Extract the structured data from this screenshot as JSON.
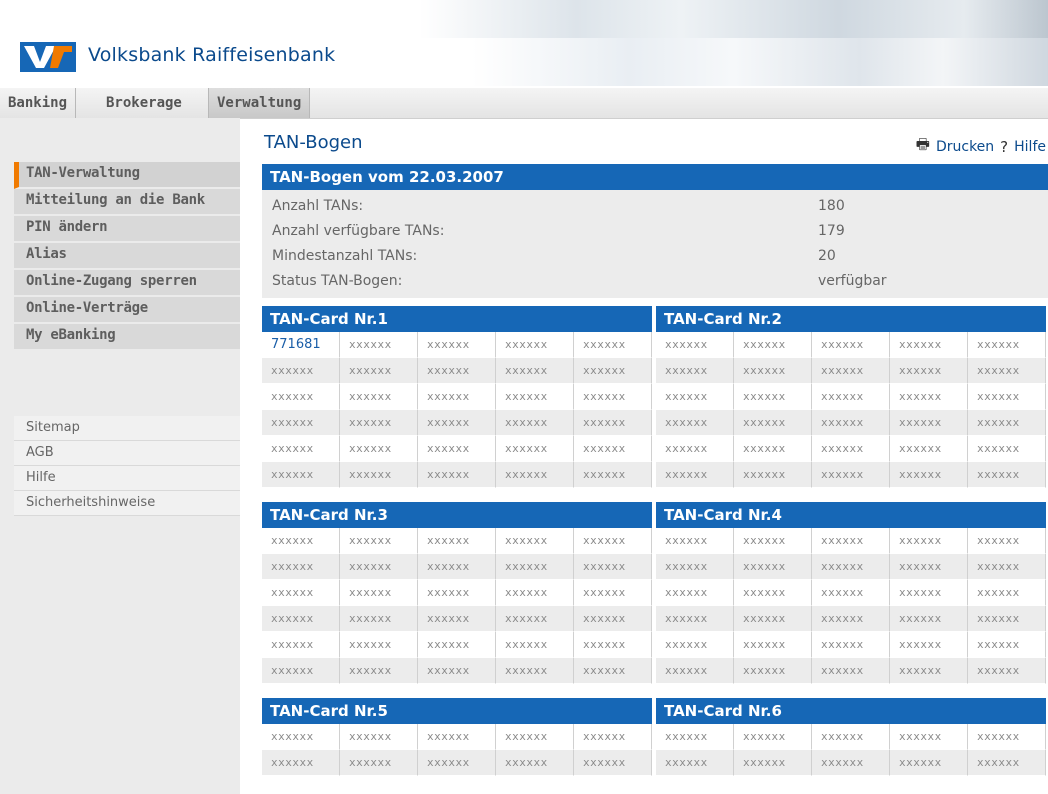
{
  "brand": {
    "name": "Volksbank Raiffeisenbank",
    "primary_color": "#1667b6",
    "accent_color": "#f07a00"
  },
  "tabs": [
    {
      "label": "Banking",
      "active": false
    },
    {
      "label": "Brokerage",
      "active": false
    },
    {
      "label": "Verwaltung",
      "active": true
    }
  ],
  "sidebar": {
    "nav": [
      {
        "label": "TAN-Verwaltung",
        "active": true
      },
      {
        "label": "Mitteilung an die Bank",
        "active": false
      },
      {
        "label": "PIN ändern",
        "active": false
      },
      {
        "label": "Alias",
        "active": false
      },
      {
        "label": "Online-Zugang sperren",
        "active": false
      },
      {
        "label": "Online-Verträge",
        "active": false
      },
      {
        "label": "My eBanking",
        "active": false
      }
    ],
    "links": [
      "Sitemap",
      "AGB",
      "Hilfe",
      "Sicherheitshinweise"
    ]
  },
  "main": {
    "title": "TAN-Bogen",
    "print_label": "Drucken",
    "help_label": "Hilfe",
    "print_icon": "printer-icon",
    "help_icon": "help-icon",
    "summary": {
      "heading": "TAN-Bogen vom 22.03.2007",
      "rows": [
        {
          "label": "Anzahl TANs:",
          "value": "180"
        },
        {
          "label": "Anzahl verfügbare TANs:",
          "value": "179"
        },
        {
          "label": "Mindestanzahl TANs:",
          "value": "20"
        },
        {
          "label": "Status TAN-Bogen:",
          "value": "verfügbar"
        }
      ]
    },
    "masked_tan": "xxxxxx",
    "cards": [
      {
        "title": "TAN-Card Nr.1",
        "first_tan": "771681"
      },
      {
        "title": "TAN-Card Nr.2"
      },
      {
        "title": "TAN-Card Nr.3"
      },
      {
        "title": "TAN-Card Nr.4"
      },
      {
        "title": "TAN-Card Nr.5"
      },
      {
        "title": "TAN-Card Nr.6"
      }
    ]
  }
}
